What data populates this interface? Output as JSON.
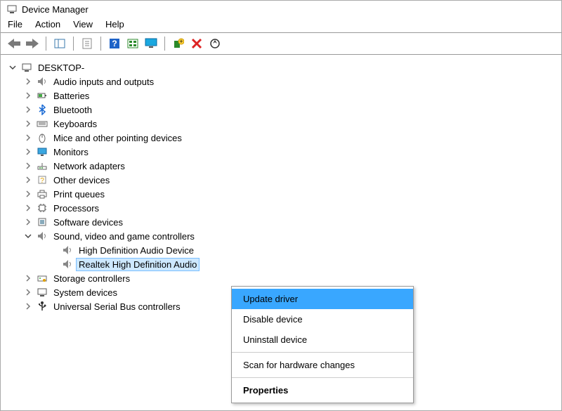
{
  "window": {
    "title": "Device Manager"
  },
  "menu": {
    "file": "File",
    "action": "Action",
    "view": "View",
    "help": "Help"
  },
  "toolbar": {
    "back": "back-icon",
    "forward": "forward-icon",
    "show_hide_tree": "show-hide-tree-icon",
    "properties": "properties-icon",
    "help": "help-icon",
    "view_devices": "view-devices-icon",
    "monitor": "monitor-icon",
    "add_hardware": "add-hardware-icon",
    "remove": "remove-icon",
    "scan": "scan-icon"
  },
  "tree": {
    "root": "DESKTOP-",
    "items": [
      {
        "label": "Audio inputs and outputs",
        "icon": "speaker-icon"
      },
      {
        "label": "Batteries",
        "icon": "battery-icon"
      },
      {
        "label": "Bluetooth",
        "icon": "bluetooth-icon"
      },
      {
        "label": "Keyboards",
        "icon": "keyboard-icon"
      },
      {
        "label": "Mice and other pointing devices",
        "icon": "mouse-icon"
      },
      {
        "label": "Monitors",
        "icon": "monitor-icon"
      },
      {
        "label": "Network adapters",
        "icon": "network-icon"
      },
      {
        "label": "Other devices",
        "icon": "other-icon"
      },
      {
        "label": "Print queues",
        "icon": "printer-icon"
      },
      {
        "label": "Processors",
        "icon": "processor-icon"
      },
      {
        "label": "Software devices",
        "icon": "software-icon"
      },
      {
        "label": "Sound, video and game controllers",
        "icon": "speaker-icon",
        "expanded": true,
        "children": [
          {
            "label": "High Definition Audio Device",
            "icon": "speaker-icon"
          },
          {
            "label": "Realtek High Definition Audio",
            "icon": "speaker-icon",
            "selected": true
          }
        ]
      },
      {
        "label": "Storage controllers",
        "icon": "storage-icon"
      },
      {
        "label": "System devices",
        "icon": "system-icon"
      },
      {
        "label": "Universal Serial Bus controllers",
        "icon": "usb-icon"
      }
    ]
  },
  "contextmenu": {
    "update": "Update driver",
    "disable": "Disable device",
    "uninstall": "Uninstall device",
    "scan": "Scan for hardware changes",
    "properties": "Properties"
  }
}
